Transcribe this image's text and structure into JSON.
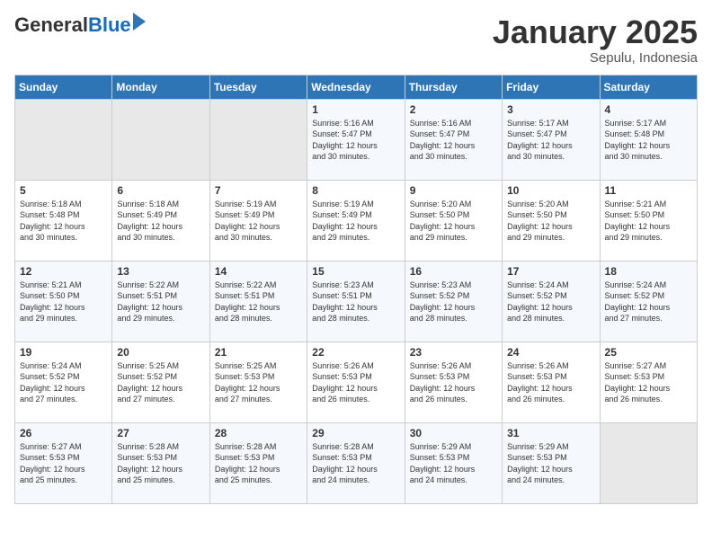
{
  "header": {
    "logo_general": "General",
    "logo_blue": "Blue",
    "month": "January 2025",
    "location": "Sepulu, Indonesia"
  },
  "days_of_week": [
    "Sunday",
    "Monday",
    "Tuesday",
    "Wednesday",
    "Thursday",
    "Friday",
    "Saturday"
  ],
  "weeks": [
    [
      {
        "num": "",
        "info": ""
      },
      {
        "num": "",
        "info": ""
      },
      {
        "num": "",
        "info": ""
      },
      {
        "num": "1",
        "info": "Sunrise: 5:16 AM\nSunset: 5:47 PM\nDaylight: 12 hours\nand 30 minutes."
      },
      {
        "num": "2",
        "info": "Sunrise: 5:16 AM\nSunset: 5:47 PM\nDaylight: 12 hours\nand 30 minutes."
      },
      {
        "num": "3",
        "info": "Sunrise: 5:17 AM\nSunset: 5:47 PM\nDaylight: 12 hours\nand 30 minutes."
      },
      {
        "num": "4",
        "info": "Sunrise: 5:17 AM\nSunset: 5:48 PM\nDaylight: 12 hours\nand 30 minutes."
      }
    ],
    [
      {
        "num": "5",
        "info": "Sunrise: 5:18 AM\nSunset: 5:48 PM\nDaylight: 12 hours\nand 30 minutes."
      },
      {
        "num": "6",
        "info": "Sunrise: 5:18 AM\nSunset: 5:49 PM\nDaylight: 12 hours\nand 30 minutes."
      },
      {
        "num": "7",
        "info": "Sunrise: 5:19 AM\nSunset: 5:49 PM\nDaylight: 12 hours\nand 30 minutes."
      },
      {
        "num": "8",
        "info": "Sunrise: 5:19 AM\nSunset: 5:49 PM\nDaylight: 12 hours\nand 29 minutes."
      },
      {
        "num": "9",
        "info": "Sunrise: 5:20 AM\nSunset: 5:50 PM\nDaylight: 12 hours\nand 29 minutes."
      },
      {
        "num": "10",
        "info": "Sunrise: 5:20 AM\nSunset: 5:50 PM\nDaylight: 12 hours\nand 29 minutes."
      },
      {
        "num": "11",
        "info": "Sunrise: 5:21 AM\nSunset: 5:50 PM\nDaylight: 12 hours\nand 29 minutes."
      }
    ],
    [
      {
        "num": "12",
        "info": "Sunrise: 5:21 AM\nSunset: 5:50 PM\nDaylight: 12 hours\nand 29 minutes."
      },
      {
        "num": "13",
        "info": "Sunrise: 5:22 AM\nSunset: 5:51 PM\nDaylight: 12 hours\nand 29 minutes."
      },
      {
        "num": "14",
        "info": "Sunrise: 5:22 AM\nSunset: 5:51 PM\nDaylight: 12 hours\nand 28 minutes."
      },
      {
        "num": "15",
        "info": "Sunrise: 5:23 AM\nSunset: 5:51 PM\nDaylight: 12 hours\nand 28 minutes."
      },
      {
        "num": "16",
        "info": "Sunrise: 5:23 AM\nSunset: 5:52 PM\nDaylight: 12 hours\nand 28 minutes."
      },
      {
        "num": "17",
        "info": "Sunrise: 5:24 AM\nSunset: 5:52 PM\nDaylight: 12 hours\nand 28 minutes."
      },
      {
        "num": "18",
        "info": "Sunrise: 5:24 AM\nSunset: 5:52 PM\nDaylight: 12 hours\nand 27 minutes."
      }
    ],
    [
      {
        "num": "19",
        "info": "Sunrise: 5:24 AM\nSunset: 5:52 PM\nDaylight: 12 hours\nand 27 minutes."
      },
      {
        "num": "20",
        "info": "Sunrise: 5:25 AM\nSunset: 5:52 PM\nDaylight: 12 hours\nand 27 minutes."
      },
      {
        "num": "21",
        "info": "Sunrise: 5:25 AM\nSunset: 5:53 PM\nDaylight: 12 hours\nand 27 minutes."
      },
      {
        "num": "22",
        "info": "Sunrise: 5:26 AM\nSunset: 5:53 PM\nDaylight: 12 hours\nand 26 minutes."
      },
      {
        "num": "23",
        "info": "Sunrise: 5:26 AM\nSunset: 5:53 PM\nDaylight: 12 hours\nand 26 minutes."
      },
      {
        "num": "24",
        "info": "Sunrise: 5:26 AM\nSunset: 5:53 PM\nDaylight: 12 hours\nand 26 minutes."
      },
      {
        "num": "25",
        "info": "Sunrise: 5:27 AM\nSunset: 5:53 PM\nDaylight: 12 hours\nand 26 minutes."
      }
    ],
    [
      {
        "num": "26",
        "info": "Sunrise: 5:27 AM\nSunset: 5:53 PM\nDaylight: 12 hours\nand 25 minutes."
      },
      {
        "num": "27",
        "info": "Sunrise: 5:28 AM\nSunset: 5:53 PM\nDaylight: 12 hours\nand 25 minutes."
      },
      {
        "num": "28",
        "info": "Sunrise: 5:28 AM\nSunset: 5:53 PM\nDaylight: 12 hours\nand 25 minutes."
      },
      {
        "num": "29",
        "info": "Sunrise: 5:28 AM\nSunset: 5:53 PM\nDaylight: 12 hours\nand 24 minutes."
      },
      {
        "num": "30",
        "info": "Sunrise: 5:29 AM\nSunset: 5:53 PM\nDaylight: 12 hours\nand 24 minutes."
      },
      {
        "num": "31",
        "info": "Sunrise: 5:29 AM\nSunset: 5:53 PM\nDaylight: 12 hours\nand 24 minutes."
      },
      {
        "num": "",
        "info": ""
      }
    ]
  ]
}
